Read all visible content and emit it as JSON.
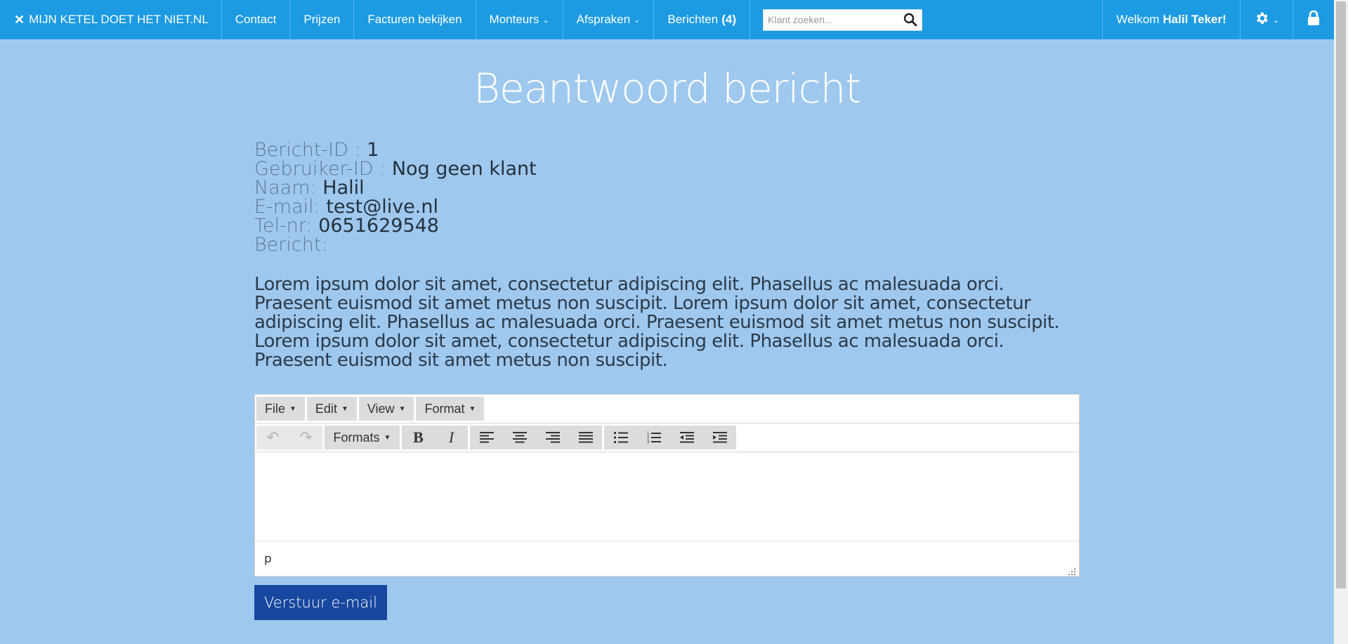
{
  "nav": {
    "brand": "MIJN KETEL DOET HET NIET.NL",
    "items": [
      {
        "label": "Contact"
      },
      {
        "label": "Prijzen"
      },
      {
        "label": "Facturen bekijken"
      },
      {
        "label": "Monteurs"
      },
      {
        "label": "Afspraken"
      }
    ],
    "messages_label": "Berichten",
    "messages_count": "(4)",
    "search_placeholder": "Klant zoeken...",
    "welcome_prefix": "Welkom",
    "welcome_name": "Halil Teker!"
  },
  "page": {
    "title": "Beantwoord bericht"
  },
  "details": {
    "message_id_label": "Bericht-ID :",
    "message_id": "1",
    "user_id_label": "Gebruiker-ID :",
    "user_id": "Nog geen klant",
    "name_label": "Naam:",
    "name": "Halil",
    "email_label": "E-mail:",
    "email": "test@live.nl",
    "phone_label": "Tel-nr:",
    "phone": "0651629548",
    "message_label": "Bericht:",
    "message": "Lorem ipsum dolor sit amet, consectetur adipiscing elit. Phasellus ac malesuada orci. Praesent euismod sit amet metus non suscipit. Lorem ipsum dolor sit amet, consectetur adipiscing elit. Phasellus ac malesuada orci. Praesent euismod sit amet metus non suscipit. Lorem ipsum dolor sit amet, consectetur adipiscing elit. Phasellus ac malesuada orci. Praesent euismod sit amet metus non suscipit."
  },
  "editor": {
    "menu": [
      "File",
      "Edit",
      "View",
      "Format"
    ],
    "formats_label": "Formats",
    "bold": "B",
    "italic": "I",
    "status_path": "p"
  },
  "actions": {
    "send_label": "Verstuur e-mail"
  },
  "colors": {
    "navbar": "#1c9be3",
    "background": "#9fc8ee",
    "send_button": "#17479e"
  }
}
